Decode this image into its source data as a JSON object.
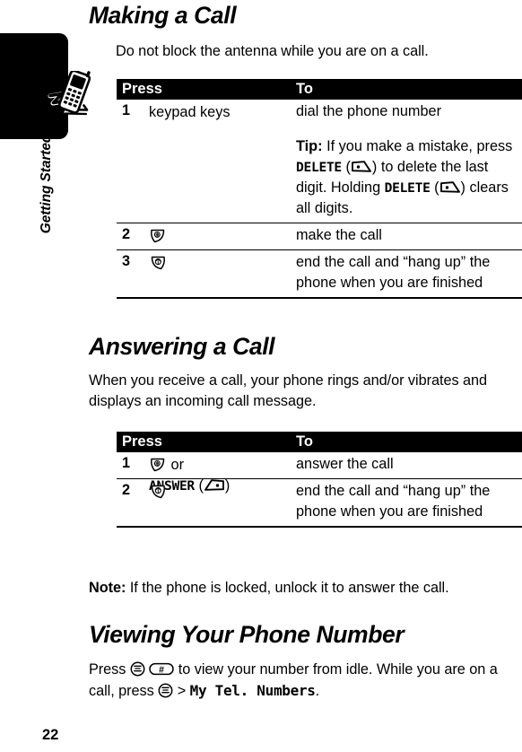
{
  "chapter": {
    "label": "Getting Started",
    "tab_icon": "flip-phone-motion-icon"
  },
  "page": {
    "number": "22"
  },
  "sections": [
    {
      "heading": "Making a Call",
      "intro": "Do not block the antenna while you are on a call."
    },
    {
      "heading": "Answering a Call",
      "intro": "When you receive a call, your phone rings and/or vibrates and displays an incoming call message."
    },
    {
      "heading": "Viewing Your Phone Number"
    }
  ],
  "table1": {
    "header": {
      "press": "Press",
      "to": "To"
    },
    "rows": [
      {
        "num": "1",
        "press": "keypad keys",
        "to_main": "dial the phone number",
        "tip_label": "Tip:",
        "tip_part1": " If you make a mistake, press ",
        "tip_key1": "DELETE",
        "tip_part2": " (",
        "tip_part3": ") to delete the last digit. Holding ",
        "tip_key2": "DELETE",
        "tip_part4": " (",
        "tip_part5": ") clears all digits.",
        "softkey_icon": "right-soft-key-icon"
      },
      {
        "num": "2",
        "press_icon": "send-key-icon",
        "to_main": "make the call"
      },
      {
        "num": "3",
        "press_icon": "end-key-icon",
        "to_main": "end the call and “hang up” the phone when you are finished"
      }
    ]
  },
  "table2": {
    "header": {
      "press": "Press",
      "to": "To"
    },
    "rows": [
      {
        "num": "1",
        "press_icon": "send-key-icon",
        "press_or": " or",
        "press_key": "ANSWER",
        "press_paren_open": " (",
        "press_paren_close": ")",
        "press_softkey_icon": "left-soft-key-icon",
        "to_main": "answer the call"
      },
      {
        "num": "2",
        "press_icon": "end-key-icon",
        "to_main": "end the call and “hang up” the phone when you are finished"
      }
    ]
  },
  "note": {
    "label": "Note:",
    "text": " If the phone is locked, unlock it to answer the call."
  },
  "viewing": {
    "part1": "Press ",
    "menu_icon": "menu-key-icon",
    "part2": " ",
    "pound_icon": "pound-key-icon",
    "part3": " to view your number from idle. While you are on a call, press ",
    "part4": " > ",
    "menu_path": "My Tel. Numbers",
    "part5": "."
  }
}
